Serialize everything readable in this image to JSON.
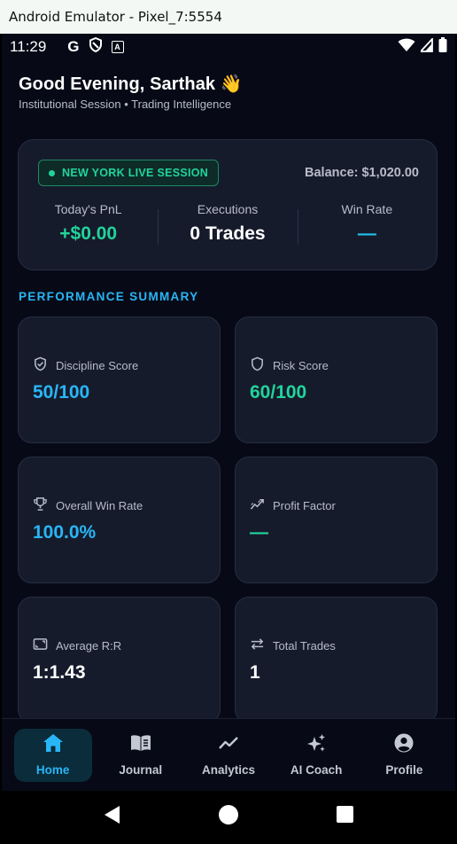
{
  "window": {
    "title": "Android Emulator - Pixel_7:5554"
  },
  "status": {
    "time": "11:29",
    "g": "G",
    "a": "A"
  },
  "greeting": {
    "title": "Good Evening, Sarthak 👋",
    "subtitle": "Institutional Session • Trading Intelligence"
  },
  "session": {
    "badge": "NEW YORK LIVE SESSION",
    "balance": "Balance: $1,020.00",
    "stats": [
      {
        "label": "Today's PnL",
        "value": "+$0.00"
      },
      {
        "label": "Executions",
        "value": "0 Trades"
      },
      {
        "label": "Win Rate",
        "value": "—"
      }
    ]
  },
  "performance": {
    "title": "PERFORMANCE SUMMARY",
    "metrics": [
      {
        "label": "Discipline Score",
        "value": "50/100",
        "icon": "shield-check-icon"
      },
      {
        "label": "Risk Score",
        "value": "60/100",
        "icon": "shield-icon"
      },
      {
        "label": "Overall Win Rate",
        "value": "100.0%",
        "icon": "trophy-icon"
      },
      {
        "label": "Profit Factor",
        "value": "—",
        "icon": "trend-icon"
      },
      {
        "label": "Average R:R",
        "value": "1:1.43",
        "icon": "ratio-icon"
      },
      {
        "label": "Total Trades",
        "value": "1",
        "icon": "swap-icon"
      }
    ]
  },
  "nav": [
    {
      "label": "Home",
      "icon": "home-icon"
    },
    {
      "label": "Journal",
      "icon": "book-icon"
    },
    {
      "label": "Analytics",
      "icon": "chart-line-icon"
    },
    {
      "label": "AI Coach",
      "icon": "sparkle-icon"
    },
    {
      "label": "Profile",
      "icon": "account-icon"
    }
  ],
  "colors": {
    "accent": "#29b6f6",
    "positive": "#21d49b",
    "background": "#070a16",
    "card": "#161b2c"
  }
}
